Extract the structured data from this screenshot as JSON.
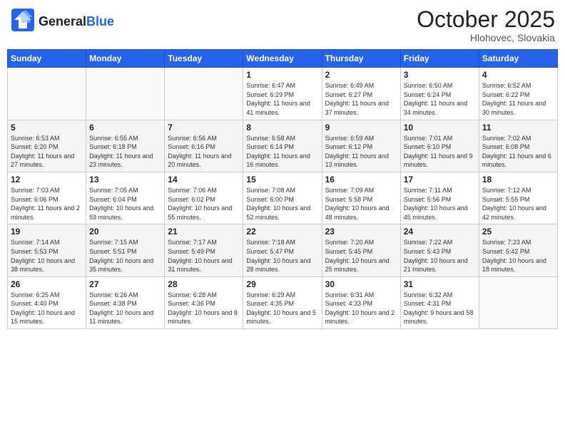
{
  "header": {
    "logo": "GeneralBlue",
    "month": "October 2025",
    "location": "Hlohovec, Slovakia"
  },
  "weekdays": [
    "Sunday",
    "Monday",
    "Tuesday",
    "Wednesday",
    "Thursday",
    "Friday",
    "Saturday"
  ],
  "weeks": [
    [
      {
        "day": "",
        "content": ""
      },
      {
        "day": "",
        "content": ""
      },
      {
        "day": "",
        "content": ""
      },
      {
        "day": "1",
        "content": "Sunrise: 6:47 AM\nSunset: 6:29 PM\nDaylight: 11 hours and 41 minutes."
      },
      {
        "day": "2",
        "content": "Sunrise: 6:49 AM\nSunset: 6:27 PM\nDaylight: 11 hours and 37 minutes."
      },
      {
        "day": "3",
        "content": "Sunrise: 6:50 AM\nSunset: 6:24 PM\nDaylight: 11 hours and 34 minutes."
      },
      {
        "day": "4",
        "content": "Sunrise: 6:52 AM\nSunset: 6:22 PM\nDaylight: 11 hours and 30 minutes."
      }
    ],
    [
      {
        "day": "5",
        "content": "Sunrise: 6:53 AM\nSunset: 6:20 PM\nDaylight: 11 hours and 27 minutes."
      },
      {
        "day": "6",
        "content": "Sunrise: 6:55 AM\nSunset: 6:18 PM\nDaylight: 11 hours and 23 minutes."
      },
      {
        "day": "7",
        "content": "Sunrise: 6:56 AM\nSunset: 6:16 PM\nDaylight: 11 hours and 20 minutes."
      },
      {
        "day": "8",
        "content": "Sunrise: 6:58 AM\nSunset: 6:14 PM\nDaylight: 11 hours and 16 minutes."
      },
      {
        "day": "9",
        "content": "Sunrise: 6:59 AM\nSunset: 6:12 PM\nDaylight: 11 hours and 13 minutes."
      },
      {
        "day": "10",
        "content": "Sunrise: 7:01 AM\nSunset: 6:10 PM\nDaylight: 11 hours and 9 minutes."
      },
      {
        "day": "11",
        "content": "Sunrise: 7:02 AM\nSunset: 6:08 PM\nDaylight: 11 hours and 6 minutes."
      }
    ],
    [
      {
        "day": "12",
        "content": "Sunrise: 7:03 AM\nSunset: 6:06 PM\nDaylight: 11 hours and 2 minutes."
      },
      {
        "day": "13",
        "content": "Sunrise: 7:05 AM\nSunset: 6:04 PM\nDaylight: 10 hours and 59 minutes."
      },
      {
        "day": "14",
        "content": "Sunrise: 7:06 AM\nSunset: 6:02 PM\nDaylight: 10 hours and 55 minutes."
      },
      {
        "day": "15",
        "content": "Sunrise: 7:08 AM\nSunset: 6:00 PM\nDaylight: 10 hours and 52 minutes."
      },
      {
        "day": "16",
        "content": "Sunrise: 7:09 AM\nSunset: 5:58 PM\nDaylight: 10 hours and 48 minutes."
      },
      {
        "day": "17",
        "content": "Sunrise: 7:11 AM\nSunset: 5:56 PM\nDaylight: 10 hours and 45 minutes."
      },
      {
        "day": "18",
        "content": "Sunrise: 7:12 AM\nSunset: 5:55 PM\nDaylight: 10 hours and 42 minutes."
      }
    ],
    [
      {
        "day": "19",
        "content": "Sunrise: 7:14 AM\nSunset: 5:53 PM\nDaylight: 10 hours and 38 minutes."
      },
      {
        "day": "20",
        "content": "Sunrise: 7:15 AM\nSunset: 5:51 PM\nDaylight: 10 hours and 35 minutes."
      },
      {
        "day": "21",
        "content": "Sunrise: 7:17 AM\nSunset: 5:49 PM\nDaylight: 10 hours and 31 minutes."
      },
      {
        "day": "22",
        "content": "Sunrise: 7:18 AM\nSunset: 5:47 PM\nDaylight: 10 hours and 28 minutes."
      },
      {
        "day": "23",
        "content": "Sunrise: 7:20 AM\nSunset: 5:45 PM\nDaylight: 10 hours and 25 minutes."
      },
      {
        "day": "24",
        "content": "Sunrise: 7:22 AM\nSunset: 5:43 PM\nDaylight: 10 hours and 21 minutes."
      },
      {
        "day": "25",
        "content": "Sunrise: 7:23 AM\nSunset: 5:42 PM\nDaylight: 10 hours and 18 minutes."
      }
    ],
    [
      {
        "day": "26",
        "content": "Sunrise: 6:25 AM\nSunset: 4:40 PM\nDaylight: 10 hours and 15 minutes."
      },
      {
        "day": "27",
        "content": "Sunrise: 6:26 AM\nSunset: 4:38 PM\nDaylight: 10 hours and 11 minutes."
      },
      {
        "day": "28",
        "content": "Sunrise: 6:28 AM\nSunset: 4:36 PM\nDaylight: 10 hours and 8 minutes."
      },
      {
        "day": "29",
        "content": "Sunrise: 6:29 AM\nSunset: 4:35 PM\nDaylight: 10 hours and 5 minutes."
      },
      {
        "day": "30",
        "content": "Sunrise: 6:31 AM\nSunset: 4:33 PM\nDaylight: 10 hours and 2 minutes."
      },
      {
        "day": "31",
        "content": "Sunrise: 6:32 AM\nSunset: 4:31 PM\nDaylight: 9 hours and 58 minutes."
      },
      {
        "day": "",
        "content": ""
      }
    ]
  ]
}
